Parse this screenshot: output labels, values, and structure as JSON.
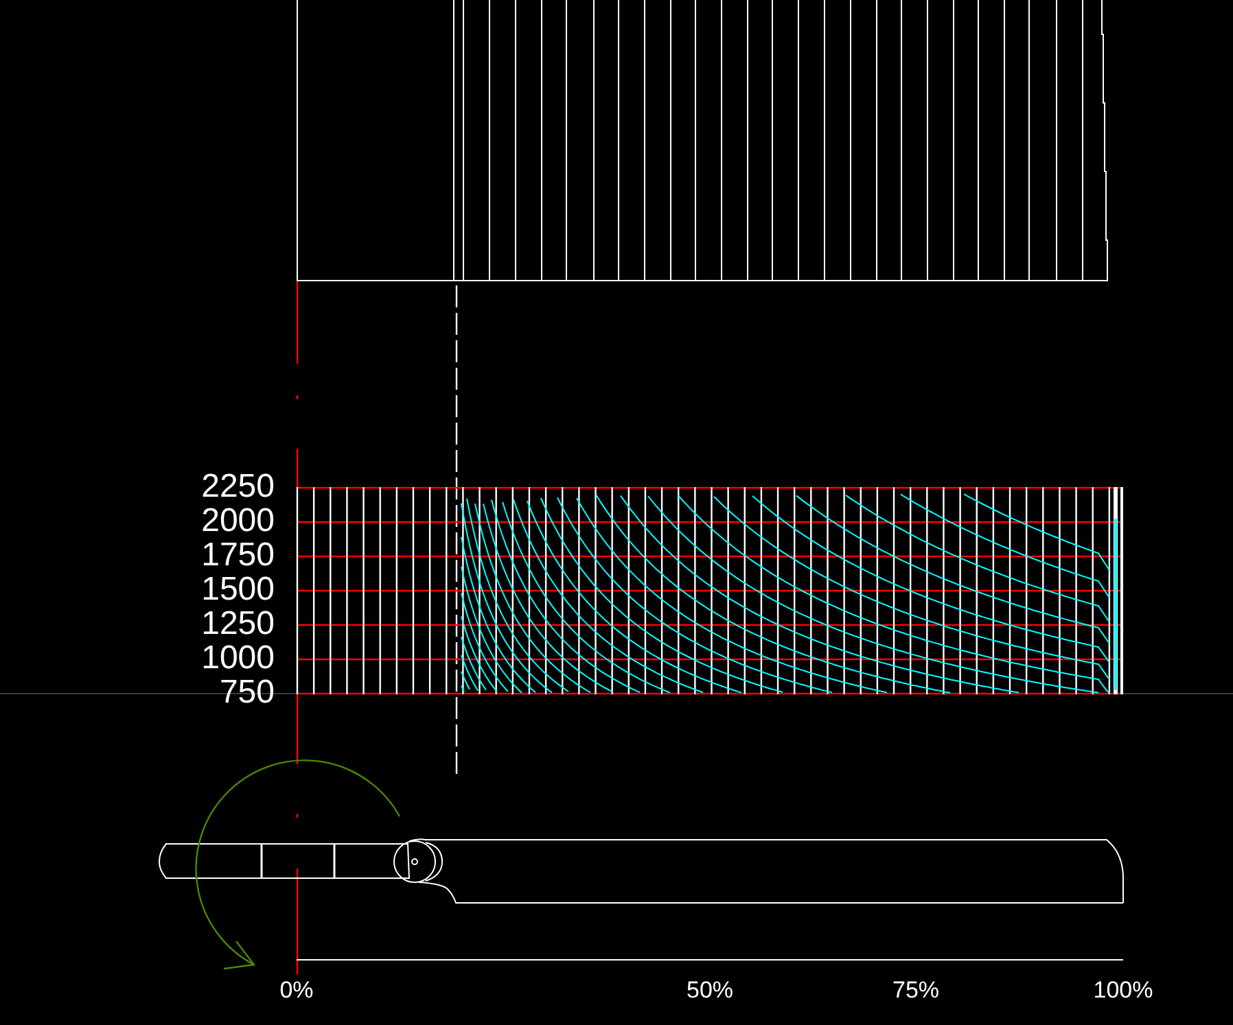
{
  "chart": {
    "y_axis_labels": [
      "2250",
      "2000",
      "1750",
      "1500",
      "1250",
      "1000",
      "750"
    ]
  },
  "scale": {
    "x_axis_labels": [
      "0%",
      "50%",
      "75%",
      "100%"
    ]
  }
}
